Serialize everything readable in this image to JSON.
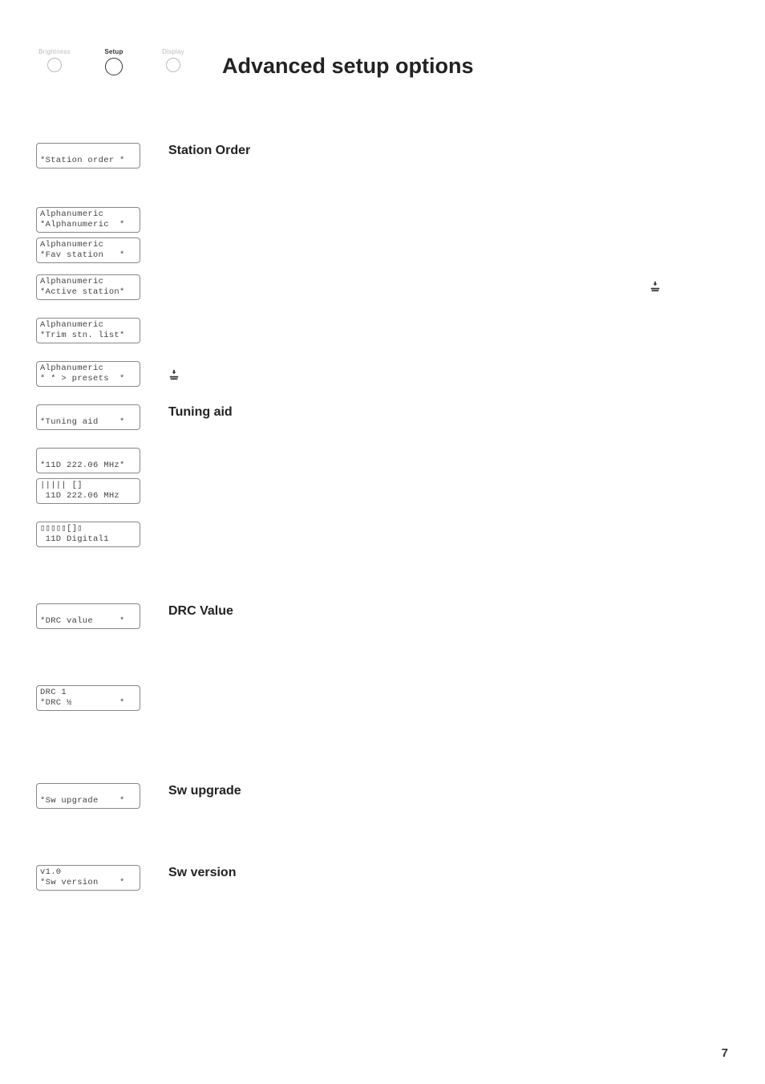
{
  "steps": [
    "Brightness",
    "Setup",
    "Display"
  ],
  "title": "Advanced setup options",
  "section": {
    "stationOrder": "Station Order",
    "tuningAid": "Tuning aid",
    "drcValue": "DRC Value",
    "swUpgrade": "Sw upgrade",
    "swVersion": "Sw version"
  },
  "lcd": {
    "stationOrder": {
      "l1": "",
      "l2": "*Station order *"
    },
    "alpha1": {
      "l1": "Alphanumeric",
      "l2": "*Alphanumeric  *"
    },
    "alpha2": {
      "l1": "Alphanumeric",
      "l2": "*Fav station   *"
    },
    "alpha3": {
      "l1": "Alphanumeric",
      "l2": "*Active station*"
    },
    "alpha4": {
      "l1": "Alphanumeric",
      "l2": "*Trim stn. list*"
    },
    "alpha5": {
      "l1": "Alphanumeric",
      "l2": "* * > presets  *"
    },
    "tuningAid": {
      "l1": "",
      "l2": "*Tuning aid    *"
    },
    "tune1": {
      "l1": "",
      "l2": "*11D 222.06 MHz*"
    },
    "tune2": {
      "l1": "||||| []",
      "l2": " 11D 222.06 MHz"
    },
    "tune3": {
      "l1": "▯▯▯▯▯[]▯",
      "l2": " 11D Digital1"
    },
    "drcValue": {
      "l1": "",
      "l2": "*DRC value     *"
    },
    "drc1": {
      "l1": "DRC 1",
      "l2": "*DRC ½         *"
    },
    "swUpgrade": {
      "l1": "",
      "l2": "*Sw upgrade    *"
    },
    "swVersion": {
      "l1": "v1.0",
      "l2": "*Sw version    *"
    }
  },
  "pageNumber": "7"
}
